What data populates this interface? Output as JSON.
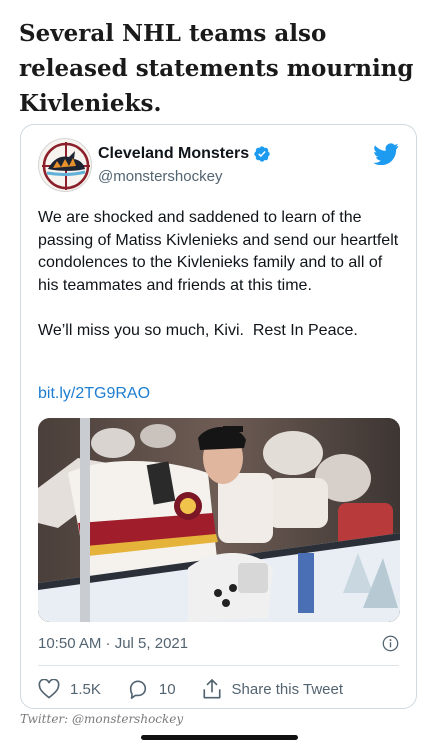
{
  "article": {
    "headline": "Several NHL teams also released statements mourning Kivlenieks.",
    "caption": "Twitter: @monstershockey"
  },
  "tweet": {
    "author_name": "Cleveland Monsters",
    "author_handle": "@monstershockey",
    "verified": true,
    "text": "We are shocked and saddened to learn of the passing of Matiss Kivlenieks and send our heartfelt condolences to the Kivlenieks family and to all of his teammates and friends at this time.\n\nWe’ll miss you so much, Kivi.  Rest In Peace.",
    "link": "bit.ly/2TG9RAO",
    "timestamp": "10:50 AM · Jul 5, 2021",
    "likes": "1.5K",
    "replies": "10",
    "share_label": "Share this Tweet"
  },
  "icons": {
    "avatar": "cleveland-monsters-logo",
    "verified": "verified-badge-icon",
    "brand": "twitter-bird-icon",
    "info": "info-icon",
    "like": "heart-icon",
    "reply": "reply-icon",
    "share": "share-icon"
  },
  "colors": {
    "twitter_blue": "#1d9bf0",
    "link": "#1d7ed1",
    "muted": "#536471",
    "border": "#cfd9de"
  }
}
